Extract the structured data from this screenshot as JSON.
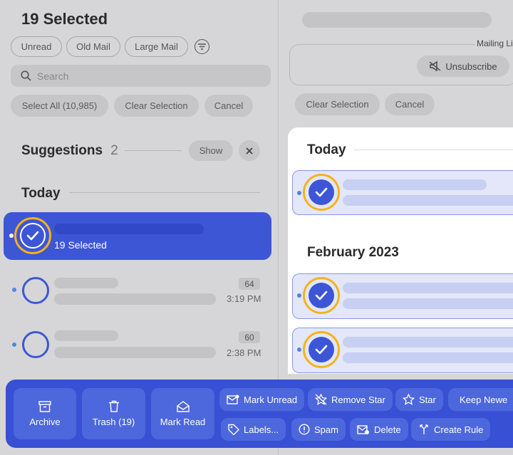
{
  "left": {
    "title": "19 Selected",
    "filters": [
      "Unread",
      "Old Mail",
      "Large Mail"
    ],
    "search_placeholder": "Search",
    "actions": [
      "Select All (10,985)",
      "Clear Selection",
      "Cancel"
    ],
    "suggestions": {
      "label": "Suggestions",
      "count": "2",
      "show": "Show"
    },
    "section_today": "Today",
    "selected_row_label": "19 Selected",
    "rows": [
      {
        "count": "64",
        "time": "3:19 PM"
      },
      {
        "count": "60",
        "time": "2:38 PM"
      }
    ]
  },
  "right": {
    "mailing_label": "Mailing Li",
    "unsubscribe": "Unsubscribe",
    "actions": [
      "Clear Selection",
      "Cancel"
    ],
    "section_today": "Today",
    "section_feb": "February 2023"
  },
  "toolbar": {
    "archive": "Archive",
    "trash": "Trash (19)",
    "mark_read": "Mark Read",
    "mark_unread": "Mark Unread",
    "remove_star": "Remove Star",
    "star": "Star",
    "keep_newest": "Keep Newe",
    "labels": "Labels...",
    "spam": "Spam",
    "delete": "Delete",
    "create_rule": "Create Rule"
  },
  "colors": {
    "accent": "#3d56d6",
    "highlight_ring": "#f5b318",
    "toolbar": "#3750d4"
  }
}
